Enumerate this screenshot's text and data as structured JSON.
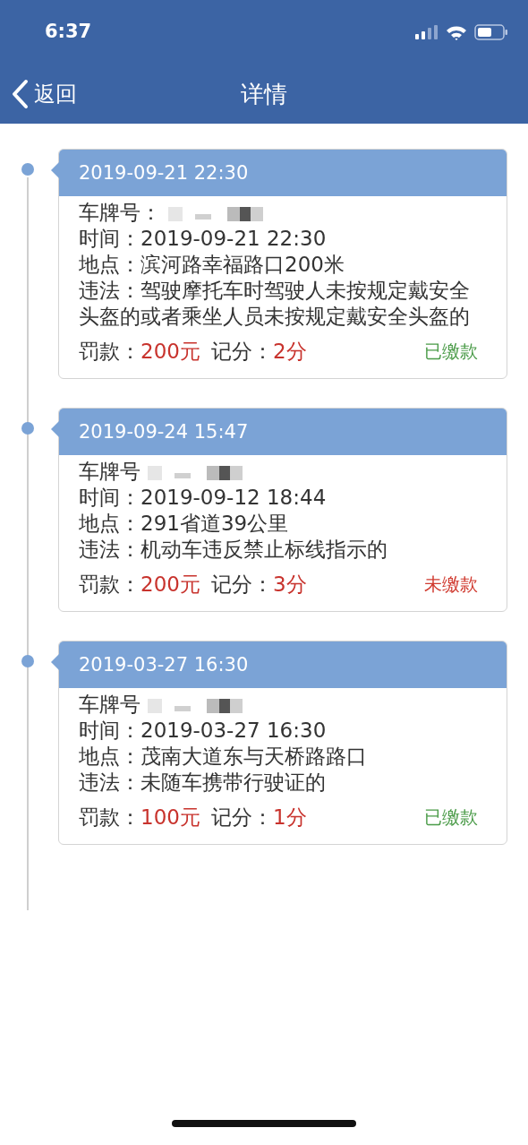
{
  "status_bar": {
    "time": "6:37"
  },
  "nav": {
    "back": "返回",
    "title": "详情"
  },
  "records": [
    {
      "date": "2019-09-21 22:30",
      "plate_label": "车牌号：",
      "time_label": "时间：",
      "time": "2019-09-21 22:30",
      "place_label": "地点：",
      "place": "滨河路幸福路口200米",
      "violation_label": "违法：",
      "violation": "驾驶摩托车时驾驶人未按规定戴安全头盔的或者乘坐人员未按规定戴安全头盔的",
      "fine_label": "罚款：",
      "fine": "200元",
      "points_label": "记分：",
      "points": "2分",
      "status": "已缴款",
      "paid": true
    },
    {
      "date": "2019-09-24 15:47",
      "plate_label": "车牌号",
      "time_label": "时间：",
      "time": "2019-09-12 18:44",
      "place_label": "地点：",
      "place": "291省道39公里",
      "violation_label": "违法：",
      "violation": "机动车违反禁止标线指示的",
      "fine_label": "罚款：",
      "fine": "200元",
      "points_label": "记分：",
      "points": "3分",
      "status": "未缴款",
      "paid": false
    },
    {
      "date": "2019-03-27 16:30",
      "plate_label": "车牌号",
      "time_label": "时间：",
      "time": "2019-03-27 16:30",
      "place_label": "地点：",
      "place": "茂南大道东与天桥路路口",
      "violation_label": "违法：",
      "violation": "未随车携带行驶证的",
      "fine_label": "罚款：",
      "fine": "100元",
      "points_label": "记分：",
      "points": "1分",
      "status": "已缴款",
      "paid": true
    }
  ]
}
